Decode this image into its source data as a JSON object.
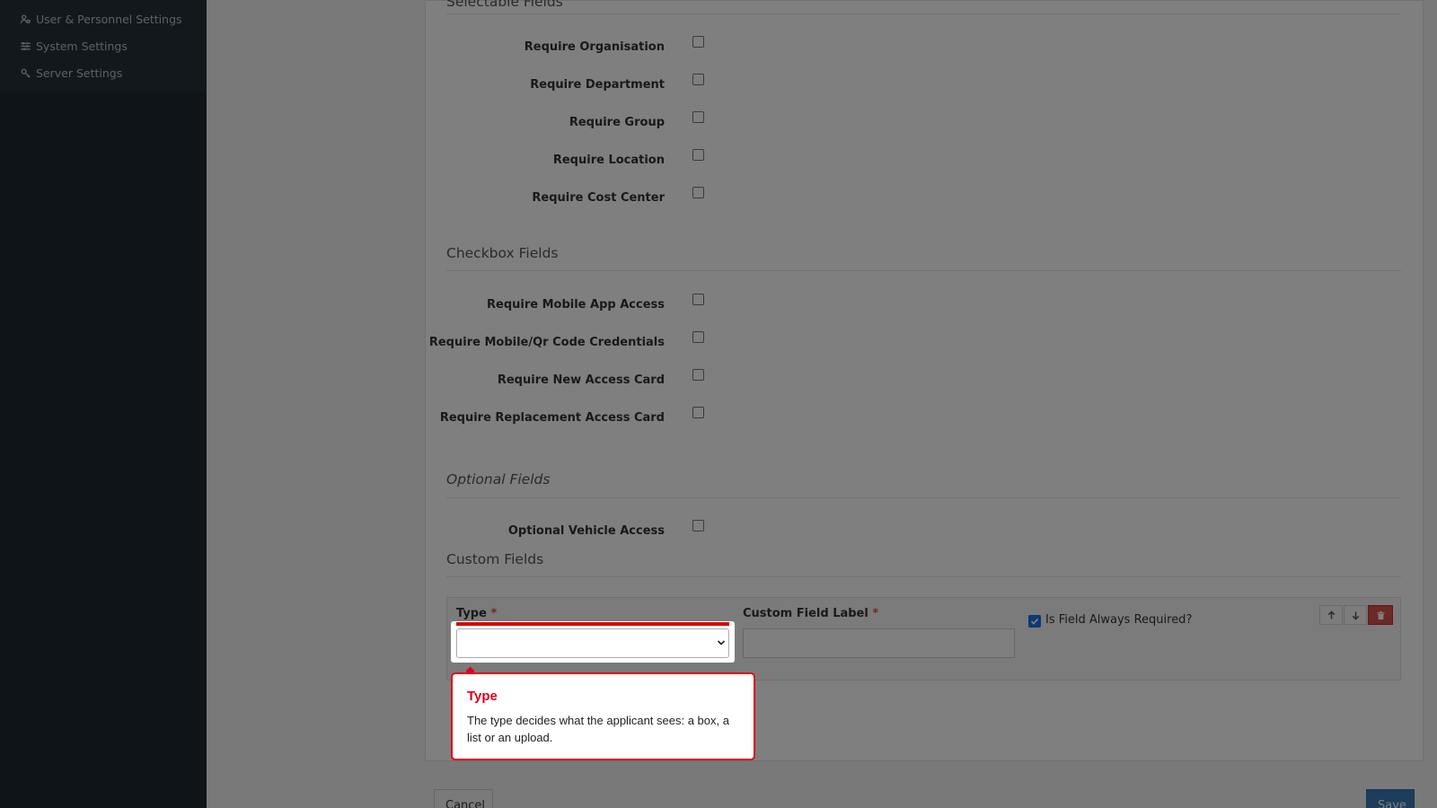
{
  "sidebar": {
    "items": [
      {
        "label": "User & Personnel Settings",
        "icon": "users-cog-icon"
      },
      {
        "label": "System Settings",
        "icon": "sliders-icon"
      },
      {
        "label": "Server Settings",
        "icon": "server-gear-icon"
      }
    ]
  },
  "sections": {
    "selectable": {
      "title": "Selectable Fields",
      "fields": [
        {
          "label": "Require Organisation",
          "checked": false
        },
        {
          "label": "Require Department",
          "checked": false
        },
        {
          "label": "Require Group",
          "checked": false
        },
        {
          "label": "Require Location",
          "checked": false
        },
        {
          "label": "Require Cost Center",
          "checked": false
        }
      ]
    },
    "checkbox": {
      "title": "Checkbox Fields",
      "fields": [
        {
          "label": "Require Mobile App Access",
          "checked": false
        },
        {
          "label": "Require Mobile/Qr Code Credentials",
          "checked": false
        },
        {
          "label": "Require New Access Card",
          "checked": false
        },
        {
          "label": "Require Replacement Access Card",
          "checked": false
        }
      ]
    },
    "optional": {
      "title": "Optional Fields",
      "fields": [
        {
          "label": "Optional Vehicle Access",
          "checked": false
        }
      ]
    },
    "custom": {
      "title": "Custom Fields",
      "type_label": "Type",
      "label_label": "Custom Field Label",
      "required_marker": "*",
      "type_value": "",
      "label_value": "",
      "always_required_label": "Is Field Always Required?",
      "always_required_checked": true
    }
  },
  "tooltip": {
    "title": "Type",
    "text": "The type decides what the applicant sees: a box, a list or an upload."
  },
  "footer": {
    "cancel_label": "Cancel",
    "save_label": "Save"
  },
  "colors": {
    "sidebar_bg": "#1e2930",
    "accent_red": "#e0001b",
    "save_blue": "#3a7bb8",
    "delete_red": "#d9534f"
  }
}
